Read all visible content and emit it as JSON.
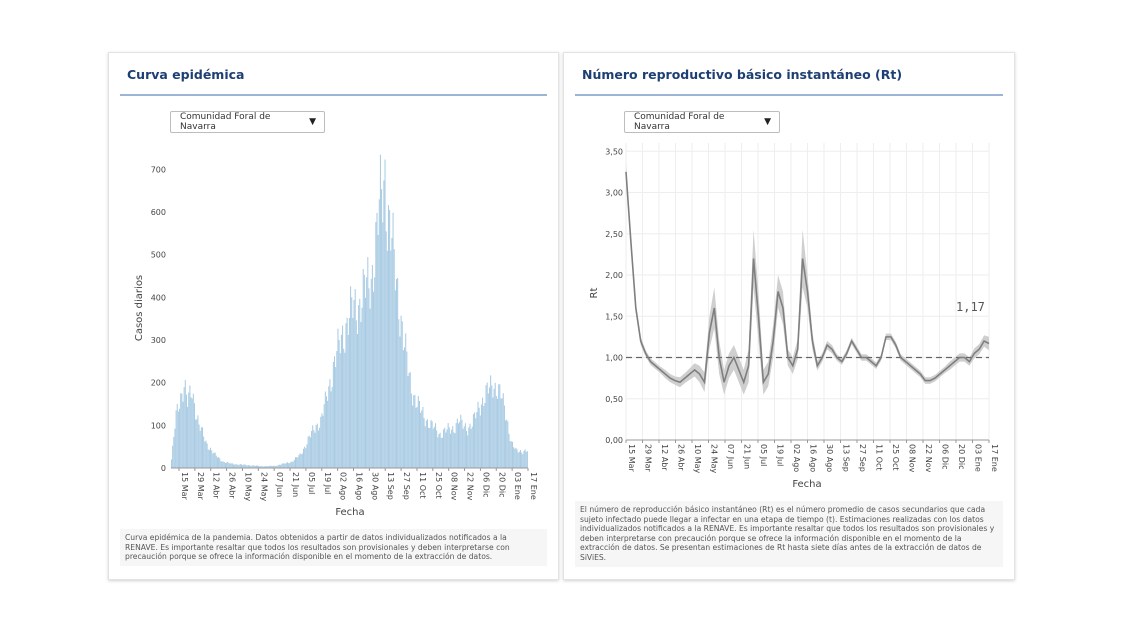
{
  "panels": {
    "left": {
      "title": "Curva epidémica",
      "dropdown_label": "Comunidad Foral de Navarra",
      "caption": "Curva epidémica de la pandemia. Datos obtenidos a partir de datos individualizados notificados a la RENAVE. Es importante resaltar que todos los resultados son provisionales y deben interpretarse con precaución porque se ofrece la información disponible en el momento de la extracción de datos."
    },
    "right": {
      "title": "Número reproductivo básico instantáneo (Rt)",
      "dropdown_label": "Comunidad Foral de Navarra",
      "caption": "El número de reproducción básico instantáneo (Rt) es el número promedio de casos secundarios que cada sujeto infectado puede llegar a infectar en una etapa de tiempo (t). Estimaciones realizadas con los datos individualizados notificados a la RENAVE. Es importante resaltar que todos los resultados son provisionales y deben interpretarse con precaución porque se ofrece la información disponible en el momento de la extracción de datos. Se presentan estimaciones de Rt hasta siete días antes de la extracción de datos de SiViES."
    }
  },
  "dropdown_caret": "▼",
  "colors": {
    "title": "#1d3f73",
    "bars": "#a9cbe3",
    "rt_line": "#7f7f7f",
    "rt_band": "#cfcfcf",
    "reference_line": "#666666"
  },
  "chart_data": [
    {
      "type": "bar",
      "title": "Curva epidémica",
      "xlabel": "Fecha",
      "ylabel": "Casos diarios",
      "ylim": [
        0,
        750
      ],
      "yticks": [
        "0",
        "100",
        "200",
        "300",
        "400",
        "500",
        "600",
        "700"
      ],
      "ytick_values": [
        0,
        100,
        200,
        300,
        400,
        500,
        600,
        700
      ],
      "xtick_labels": [
        "15 Mar",
        "29 Mar",
        "12 Abr",
        "26 Abr",
        "10 May",
        "24 May",
        "07 Jun",
        "21 Jun",
        "05 Jul",
        "19 Jul",
        "02 Ago",
        "16 Ago",
        "30 Ago",
        "13 Sep",
        "27 Sep",
        "11 Oct",
        "25 Oct",
        "08 Nov",
        "22 Nov",
        "06 Dic",
        "20 Dic",
        "03 Ene",
        "17 Ene"
      ],
      "grid": false,
      "series_keyframes": {
        "day_index_from_15_Mar": [
          0,
          4,
          8,
          11,
          14,
          18,
          24,
          30,
          38,
          45,
          52,
          60,
          70,
          80,
          90,
          98,
          105,
          112,
          118,
          122,
          126,
          130,
          134,
          138,
          142,
          146,
          150,
          154,
          158,
          162,
          166,
          170,
          174,
          178,
          182,
          186,
          188,
          190,
          194,
          198,
          202,
          206,
          210,
          214,
          218,
          222,
          226,
          230,
          234,
          238,
          242,
          246,
          250,
          254,
          258,
          262,
          266,
          268,
          272,
          276,
          280,
          284,
          288,
          292,
          296,
          300,
          304,
          308,
          310
        ],
        "casos_diarios": [
          20,
          120,
          170,
          200,
          150,
          180,
          100,
          60,
          30,
          15,
          10,
          8,
          6,
          4,
          5,
          10,
          15,
          30,
          60,
          80,
          100,
          110,
          150,
          200,
          250,
          280,
          320,
          350,
          370,
          380,
          400,
          420,
          450,
          520,
          620,
          700,
          600,
          560,
          480,
          400,
          300,
          230,
          180,
          150,
          130,
          115,
          100,
          90,
          80,
          85,
          90,
          95,
          110,
          100,
          95,
          100,
          130,
          150,
          160,
          180,
          200,
          185,
          160,
          120,
          60,
          40,
          40,
          40,
          40
        ]
      }
    },
    {
      "type": "line",
      "title": "Número reproductivo básico instantáneo (Rt)",
      "xlabel": "Fecha",
      "ylabel": "Rt",
      "ylim": [
        0,
        3.6
      ],
      "yticks": [
        "0,00",
        "0,50",
        "1,00",
        "1,50",
        "2,00",
        "2,50",
        "3,00",
        "3,50"
      ],
      "ytick_values": [
        0,
        0.5,
        1.0,
        1.5,
        2.0,
        2.5,
        3.0,
        3.5
      ],
      "xtick_labels": [
        "15 Mar",
        "29 Mar",
        "12 Abr",
        "26 Abr",
        "10 May",
        "24 May",
        "07 Jun",
        "21 Jun",
        "05 Jul",
        "19 Jul",
        "02 Ago",
        "16 Ago",
        "30 Ago",
        "13 Sep",
        "27 Sep",
        "11 Oct",
        "25 Oct",
        "08 Nov",
        "22 Nov",
        "06 Dic",
        "20 Dic",
        "03 Ene",
        "17 Ene"
      ],
      "grid": true,
      "reference_line": 1.0,
      "last_value_label": "1,17",
      "series_keyframes": {
        "day_index_from_15_Mar": [
          0,
          4,
          8,
          12,
          16,
          20,
          24,
          28,
          32,
          36,
          40,
          44,
          48,
          52,
          56,
          60,
          64,
          68,
          72,
          76,
          80,
          84,
          88,
          92,
          96,
          100,
          104,
          108,
          112,
          116,
          120,
          124,
          128,
          132,
          136,
          140,
          144,
          148,
          152,
          156,
          160,
          164,
          168,
          172,
          176,
          180,
          184,
          188,
          192,
          196,
          200,
          204,
          208,
          212,
          216,
          220,
          224,
          228,
          232,
          236,
          240,
          244,
          248,
          252,
          256,
          260,
          264,
          268,
          272,
          276,
          280,
          284,
          288,
          292,
          296
        ],
        "rt": [
          3.25,
          2.4,
          1.6,
          1.2,
          1.05,
          0.95,
          0.9,
          0.85,
          0.8,
          0.75,
          0.72,
          0.7,
          0.75,
          0.8,
          0.85,
          0.8,
          0.7,
          1.3,
          1.6,
          1.0,
          0.7,
          0.9,
          1.0,
          0.85,
          0.7,
          0.9,
          2.2,
          1.5,
          0.7,
          0.8,
          1.2,
          1.8,
          1.6,
          1.0,
          0.9,
          1.1,
          2.2,
          1.8,
          1.2,
          0.9,
          1.0,
          1.15,
          1.1,
          1.0,
          0.95,
          1.05,
          1.2,
          1.1,
          1.0,
          1.0,
          0.95,
          0.9,
          1.0,
          1.25,
          1.25,
          1.15,
          1.0,
          0.95,
          0.9,
          0.85,
          0.8,
          0.72,
          0.72,
          0.75,
          0.8,
          0.85,
          0.9,
          0.95,
          1.0,
          1.0,
          0.95,
          1.05,
          1.1,
          1.2,
          1.17
        ],
        "band_halfwidth": [
          0.1,
          0.08,
          0.06,
          0.05,
          0.04,
          0.04,
          0.04,
          0.04,
          0.05,
          0.05,
          0.05,
          0.06,
          0.06,
          0.07,
          0.08,
          0.1,
          0.12,
          0.2,
          0.25,
          0.2,
          0.15,
          0.15,
          0.15,
          0.15,
          0.15,
          0.2,
          0.35,
          0.3,
          0.15,
          0.15,
          0.2,
          0.2,
          0.2,
          0.1,
          0.1,
          0.12,
          0.35,
          0.2,
          0.1,
          0.06,
          0.05,
          0.05,
          0.05,
          0.04,
          0.04,
          0.04,
          0.04,
          0.04,
          0.04,
          0.04,
          0.04,
          0.04,
          0.04,
          0.04,
          0.04,
          0.04,
          0.04,
          0.04,
          0.04,
          0.04,
          0.04,
          0.04,
          0.04,
          0.04,
          0.04,
          0.04,
          0.05,
          0.05,
          0.05,
          0.05,
          0.05,
          0.06,
          0.06,
          0.07,
          0.08
        ]
      }
    }
  ]
}
